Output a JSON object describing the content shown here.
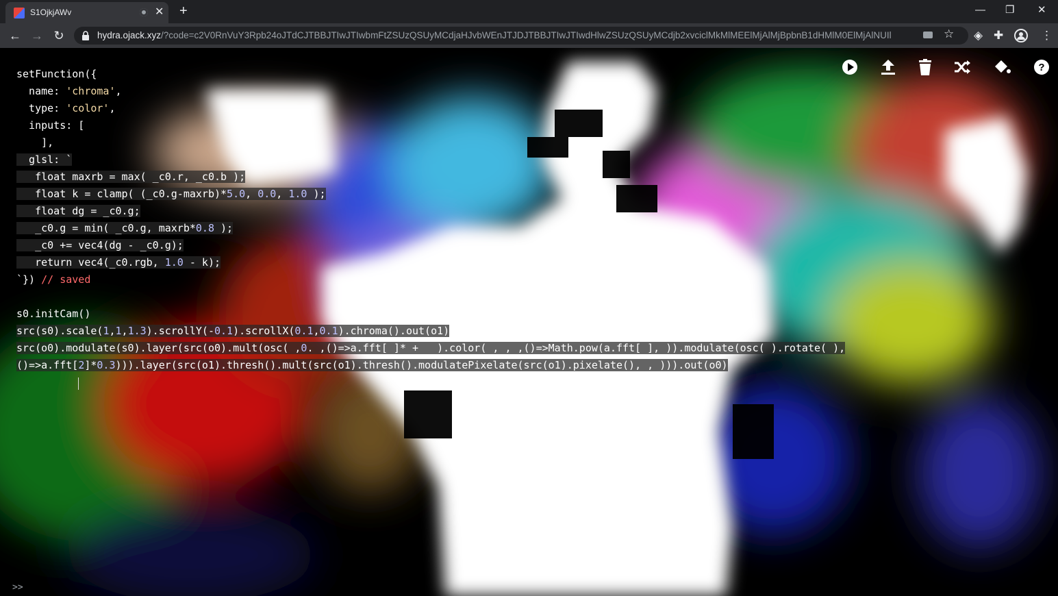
{
  "browser": {
    "tab_title": "S1OjkjAWv",
    "tab_close": "✕",
    "new_tab": "+",
    "url_host": "hydra.ojack.xyz",
    "url_rest": "/?code=c2V0RnVuY3Rpb24oJTdCJTBBJTIwJTIwbmFtZSUzQSUyMCdjaHJvbWEnJTJDJTBBJTIwJTIwdHlwZSUzQSUyMCdjb2xvciclMkMlMEElMjAlMjBpbnB1dHMlM0ElMjAlNUIlMEEl...",
    "window_controls": [
      "—",
      "❐",
      "✕"
    ]
  },
  "toolbar": {
    "icons": [
      "play-icon",
      "upload-icon",
      "trash-icon",
      "shuffle-icon",
      "paint-bucket-icon",
      "help-icon"
    ]
  },
  "editor": {
    "lines": [
      {
        "text": "setFunction({",
        "hl": false
      },
      {
        "text": "  name: 'chroma',",
        "hl": false
      },
      {
        "text": "  type: 'color',",
        "hl": false
      },
      {
        "text": "  inputs: [",
        "hl": false
      },
      {
        "text": "    ],",
        "hl": false
      },
      {
        "text": "  glsl: `",
        "hl": true
      },
      {
        "text": "   float maxrb = max( _c0.r, _c0.b );",
        "hl": true
      },
      {
        "text": "   float k = clamp( (_c0.g-maxrb)*5.0, 0.0, 1.0 );",
        "hl": true
      },
      {
        "text": "   float dg = _c0.g;",
        "hl": true
      },
      {
        "text": "   _c0.g = min( _c0.g, maxrb*0.8 );",
        "hl": true
      },
      {
        "text": "   _c0 += vec4(dg - _c0.g);",
        "hl": true
      },
      {
        "text": "   return vec4(_c0.rgb, 1.0 - k);",
        "hl": true
      },
      {
        "text": "`}) // saved",
        "hl": false
      },
      {
        "text": "",
        "hl": false
      },
      {
        "text": "s0.initCam()",
        "hl": false
      },
      {
        "text": "src(s0).scale(1,1,1.3).scrollY(-0.1).scrollX(0.1,0.1).chroma().out(o1)",
        "hl": true
      },
      {
        "text": "src(o0).modulate(s0).layer(src(o0).mult(osc( ,0. ,()=>a.fft[ ]* +   ).color( , , ,()=>Math.pow(a.fft[ ], )).modulate(osc( ).rotate( ),",
        "hl": true
      },
      {
        "text": "()=>a.fft[2]*0.3))).layer(src(o1).thresh().mult(src(o1).thresh().modulatePixelate(src(o1).pixelate(), , ))).out(o0)",
        "hl": true
      }
    ],
    "prompt": ">>"
  }
}
